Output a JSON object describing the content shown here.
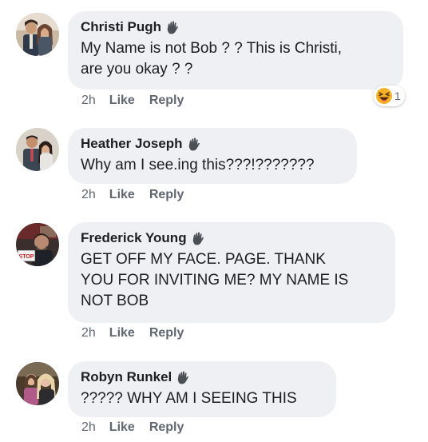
{
  "comments": [
    {
      "name": "Christi Pugh",
      "text_lines": [
        "My Name is not Bob ? ? This is Christi,",
        "are you okay ? ?"
      ],
      "time": "2h",
      "like": "Like",
      "reply": "Reply",
      "reaction": {
        "icon": "laugh-haha-icon",
        "count": "1"
      },
      "avatar": "avatar-couple-photo"
    },
    {
      "name": "Heather Joseph",
      "text_lines": [
        "Why am I see.ing this???!???????"
      ],
      "time": "2h",
      "like": "Like",
      "reply": "Reply",
      "avatar": "avatar-couple-photo"
    },
    {
      "name": "Frederick Young",
      "text_lines": [
        "GET OFF MY FACE. PAGE. THANK",
        "YOU FOR INVITING ME? MY NAME IS",
        "NOT BOB"
      ],
      "time": "2h",
      "like": "Like",
      "reply": "Reply",
      "avatar": "avatar-man-with-stop-sign"
    },
    {
      "name": "Robyn Runkel",
      "text_lines": [
        "????? WHY AM I SEEING THIS"
      ],
      "time": "2h",
      "like": "Like",
      "reply": "Reply",
      "avatar": "avatar-two-women-photo"
    }
  ],
  "avatar_sign_text": "STOP",
  "colors": {
    "bubble": "#eef0f3",
    "meta_text": "#606770",
    "name_text": "#1c1e21",
    "reaction_yellow": "#f7b125"
  }
}
